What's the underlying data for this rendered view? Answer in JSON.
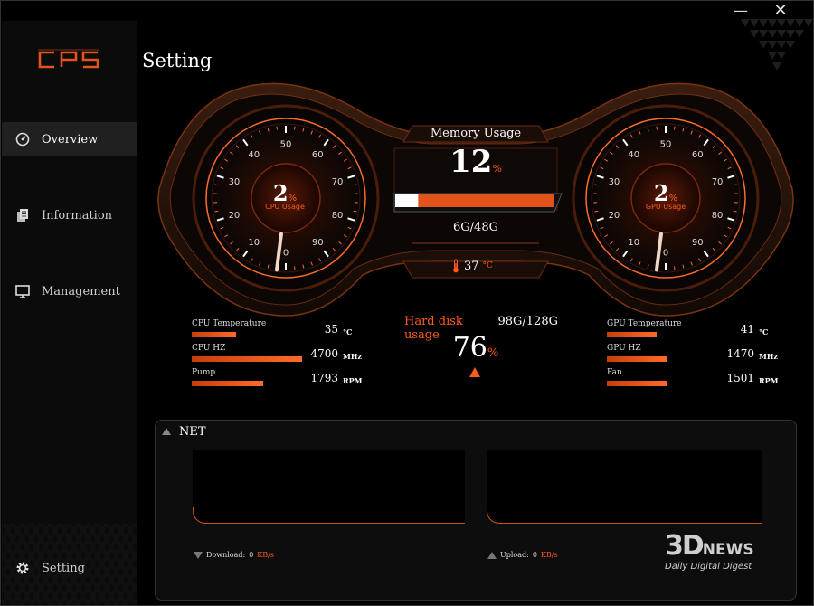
{
  "window": {
    "minimize_glyph": "—",
    "close_glyph": "✕"
  },
  "brand": {
    "logo_text": "CPS",
    "accent": "#ff5a1f",
    "accent_dark": "#c63d0c",
    "bg": "#000000"
  },
  "sidebar": {
    "items": [
      {
        "label": "Overview",
        "icon": "speedometer-icon",
        "active": true
      },
      {
        "label": "Information",
        "icon": "document-icon",
        "active": false
      },
      {
        "label": "Management",
        "icon": "monitor-icon",
        "active": false
      }
    ],
    "footer": {
      "label": "Setting",
      "icon": "gear-icon"
    }
  },
  "page": {
    "title": "Setting"
  },
  "cpu_gauge": {
    "value": "2",
    "unit": "%",
    "label": "CPU Usage",
    "level": 2,
    "ticks": [
      "0",
      "10",
      "20",
      "30",
      "40",
      "50",
      "60",
      "70",
      "80",
      "90"
    ]
  },
  "gpu_gauge": {
    "value": "2",
    "unit": "%",
    "label": "GPU Usage",
    "level": 2,
    "ticks": [
      "0",
      "10",
      "20",
      "30",
      "40",
      "50",
      "60",
      "70",
      "80",
      "90"
    ]
  },
  "memory": {
    "label": "Memory Usage",
    "value": "12",
    "unit": "%",
    "detail": "6G/48G",
    "level": 12
  },
  "temperature": {
    "value": "37",
    "unit": "°C"
  },
  "hdd": {
    "label": "Hard disk usage",
    "detail": "98G/128G",
    "value": "76",
    "unit": "%"
  },
  "cpu_stats": [
    {
      "label": "CPU Temperature",
      "value": "35",
      "unit": "°C",
      "level": 0.4
    },
    {
      "label": "CPU HZ",
      "value": "4700",
      "unit": "MHz",
      "level": 1.0
    },
    {
      "label": "Pump",
      "value": "1793",
      "unit": "RPM",
      "level": 0.65
    }
  ],
  "gpu_stats": [
    {
      "label": "GPU Temperature",
      "value": "41",
      "unit": "°C",
      "level": 0.45
    },
    {
      "label": "GPU HZ",
      "value": "1470",
      "unit": "MHz",
      "level": 0.55
    },
    {
      "label": "Fan",
      "value": "1501",
      "unit": "RPM",
      "level": 0.55
    }
  ],
  "net": {
    "title": "NET",
    "download": {
      "label": "Download:",
      "value": "0",
      "unit": "KB/s"
    },
    "upload": {
      "label": "Upload:",
      "value": "0",
      "unit": "KB/s"
    }
  },
  "watermark": {
    "brand_a": "3D",
    "brand_b": "NEWS",
    "tagline": "Daily Digital Digest"
  }
}
